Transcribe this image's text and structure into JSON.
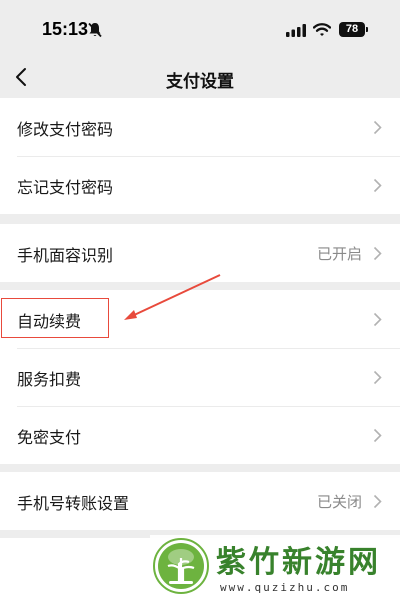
{
  "status_bar": {
    "time": "15:13",
    "battery_level": "78"
  },
  "nav": {
    "title": "支付设置"
  },
  "groups": [
    {
      "rows": [
        {
          "label": "修改支付密码",
          "value": ""
        },
        {
          "label": "忘记支付密码",
          "value": ""
        }
      ]
    },
    {
      "rows": [
        {
          "label": "手机面容识别",
          "value": "已开启"
        }
      ]
    },
    {
      "rows": [
        {
          "label": "自动续费",
          "value": ""
        },
        {
          "label": "服务扣费",
          "value": ""
        },
        {
          "label": "免密支付",
          "value": ""
        }
      ]
    },
    {
      "rows": [
        {
          "label": "手机号转账设置",
          "value": "已关闭"
        }
      ]
    }
  ],
  "annotation": {
    "color": "#e84a3c"
  },
  "watermark": {
    "title": "紫竹新游网",
    "url": "www.quzizhu.com",
    "color": "#38822c"
  }
}
